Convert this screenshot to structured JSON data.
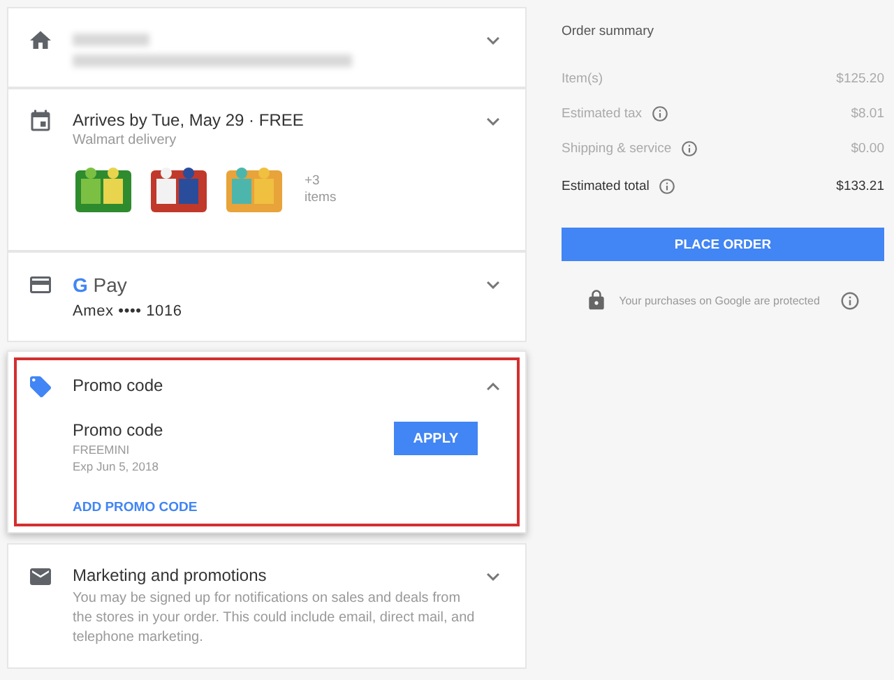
{
  "sections": [
    {
      "kind": "address",
      "expanded": false
    },
    {
      "kind": "delivery",
      "expanded": false,
      "title": "Arrives by Tue, May 29 · FREE",
      "subtitle": "Walmart delivery",
      "more_items": [
        "+3",
        "items"
      ],
      "products": [
        {
          "kind": "picture"
        },
        {
          "kind": "picture"
        },
        {
          "kind": "picture"
        }
      ]
    },
    {
      "kind": "payment",
      "expanded": false,
      "wallet": "G Pay",
      "card": "Amex •••• 1016"
    },
    {
      "kind": "promo",
      "expanded": true,
      "highlighted": true,
      "title": "Promo code",
      "code_label": "Promo code",
      "code": "FREEMINI",
      "expiry": "Exp Jun 5, 2018",
      "apply": "APPLY",
      "add": "ADD PROMO CODE"
    },
    {
      "kind": "marketing",
      "expanded": false,
      "title": "Marketing and promotions",
      "text": "You may be signed up for notifications on sales and deals from the stores in your order. This could include email, direct mail, and telephone marketing."
    }
  ],
  "summary": {
    "title": "Order summary",
    "rows": [
      {
        "label": "Item(s)",
        "value": "$125.20",
        "info": false,
        "emphasis": false
      },
      {
        "label": "Estimated tax",
        "value": "$8.01",
        "info": true,
        "emphasis": false
      },
      {
        "label": "Shipping & service",
        "value": "$0.00",
        "info": true,
        "emphasis": false
      },
      {
        "label": "Estimated total",
        "value": "$133.21",
        "info": true,
        "emphasis": true
      }
    ],
    "button": "PLACE ORDER",
    "protected": "Your purchases on Google are protected"
  }
}
